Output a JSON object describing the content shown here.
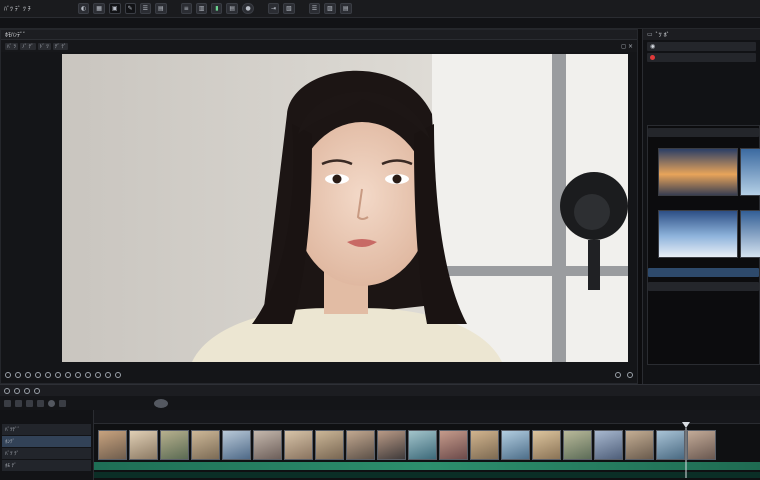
{
  "app": {
    "title": "ﾊﾞﾂ ﾃﾞ ﾂ ﾁ"
  },
  "toolbar": {
    "buttons": [
      "icon",
      "icon",
      "icon",
      "icon",
      "icon",
      "icon",
      "icon",
      "icon",
      "icon",
      "icon",
      "icon",
      "icon"
    ]
  },
  "viewer": {
    "title": "ﾎﾓﾊﾝﾃﾞﾞ",
    "tools": [
      "ﾊﾞ ﾂ",
      "ﾉﾞ ﾃﾞ",
      "ﾄﾞ ﾂ",
      "ﾃﾞ ﾃﾞ"
    ],
    "close": "◻ ×"
  },
  "right_panel": {
    "tab": "ﾞﾂ ﾎﾞ"
  },
  "timeline": {
    "tracks": [
      "ﾊﾞﾂﾃﾞﾞ",
      "ﾎﾝﾃﾞ",
      "ﾊﾞﾂ ﾃﾞ",
      "ﾎﾓ ﾃﾞ"
    ]
  },
  "colors": {
    "accent": "#2c8f6d",
    "record": "#e03a3a",
    "panel": "#141518"
  }
}
